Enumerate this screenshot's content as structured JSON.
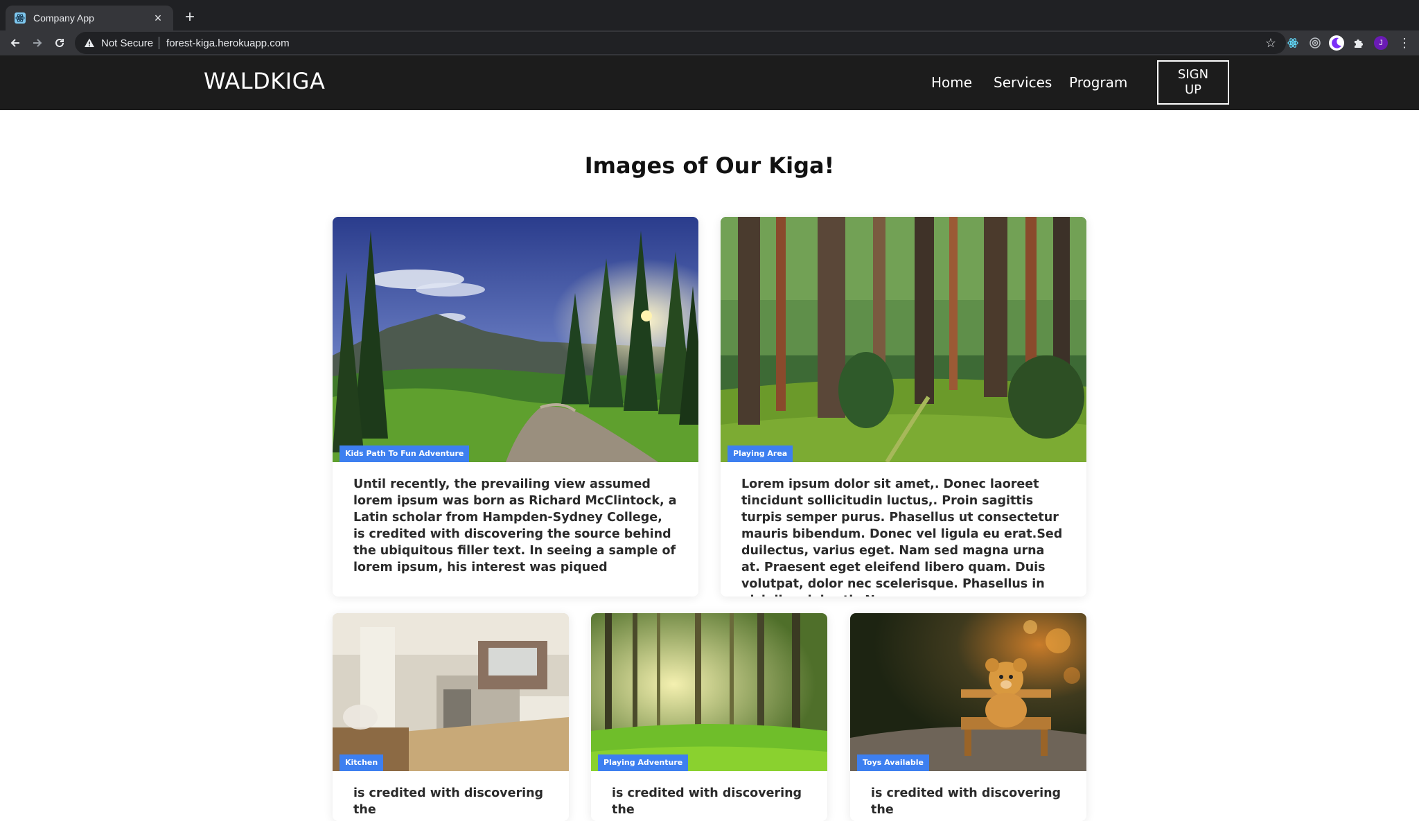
{
  "browser": {
    "tab_title": "Company App",
    "security_label": "Not Secure",
    "url": "forest-kiga.herokuapp.com",
    "profile_initial": "J"
  },
  "site": {
    "brand": "WALDKIGA",
    "nav": [
      "Home",
      "Services",
      "Program"
    ],
    "signup_label": "SIGN UP"
  },
  "main": {
    "title": "Images of Our Kiga!",
    "cards": [
      {
        "badge": "Kids Path To Fun Adventure",
        "text": "Until recently, the prevailing view assumed lorem ipsum was born as Richard McClintock, a Latin scholar from Hampden-Sydney College, is credited with discovering the source behind the ubiquitous filler text. In seeing a sample of lorem ipsum, his interest was piqued"
      },
      {
        "badge": "Playing Area",
        "text": "Lorem ipsum dolor sit amet,. Donec laoreet tincidunt sollicitudin luctus,. Proin sagittis turpis semper purus. Phasellus ut consectetur mauris bibendum. Donec vel ligula eu erat.Sed duilectus, varius eget. Nam sed magna urna at. Praesent eget eleifend libero quam. Duis volutpat, dolor nec scelerisque. Phasellus in nisi diam lobortis.Nam."
      },
      {
        "badge": "Kitchen",
        "text": "is credited with discovering the"
      },
      {
        "badge": "Playing Adventure",
        "text": "is credited with discovering the"
      },
      {
        "badge": "Toys Available",
        "text": "is credited with discovering the"
      }
    ]
  },
  "colors": {
    "header_bg": "#1c1c1c",
    "badge_bg": "#3d7ff0",
    "browser_tab_bg": "#35363a",
    "browser_strip_bg": "#202124"
  }
}
